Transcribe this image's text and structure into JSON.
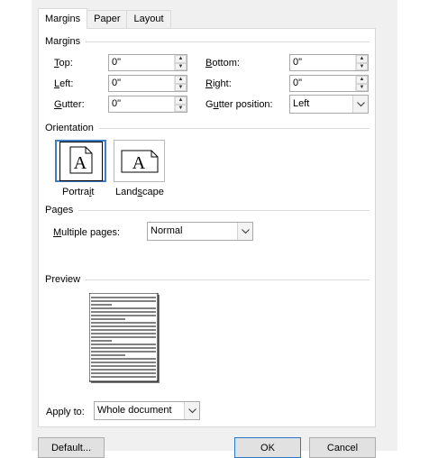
{
  "tabs": [
    "Margins",
    "Paper",
    "Layout"
  ],
  "margins_section": {
    "title": "Margins",
    "top": {
      "accel": "T",
      "rest": "op:",
      "value": "0\""
    },
    "bottom": {
      "accel": "B",
      "rest": "ottom:",
      "value": "0\""
    },
    "left": {
      "accel": "L",
      "rest": "eft:",
      "value": "0\""
    },
    "right": {
      "accel": "R",
      "rest": "ight:",
      "value": "0\""
    },
    "gutter": {
      "accel": "G",
      "rest": "utter:",
      "value": "0\""
    },
    "gutter_position": {
      "pre": "G",
      "accel": "u",
      "rest": "tter position:",
      "value": "Left"
    }
  },
  "orientation_section": {
    "title": "Orientation",
    "portrait": {
      "pre": "Portra",
      "accel": "i",
      "rest": "t",
      "glyph": "A"
    },
    "landscape": {
      "pre": "Land",
      "accel": "s",
      "rest": "cape",
      "glyph": "A"
    }
  },
  "pages_section": {
    "title": "Pages",
    "multiple_pages": {
      "accel": "M",
      "rest": "ultiple pages:",
      "value": "Normal"
    }
  },
  "preview_section": {
    "title": "Preview"
  },
  "apply_to": {
    "pre": "Apply to",
    "accel": "",
    "rest": ":",
    "value": "Whole document"
  },
  "buttons": {
    "default": "Default...",
    "ok": "OK",
    "cancel": "Cancel"
  },
  "icons": {
    "spin_up": "spin-up-arrow-icon",
    "spin_down": "spin-down-arrow-icon",
    "dropdown": "chevron-down-icon",
    "page": "page-icon"
  },
  "colors": {
    "accent": "#3c7fc4",
    "dialog_bg": "#f0f0f0",
    "frame": "#7aa7d6"
  }
}
